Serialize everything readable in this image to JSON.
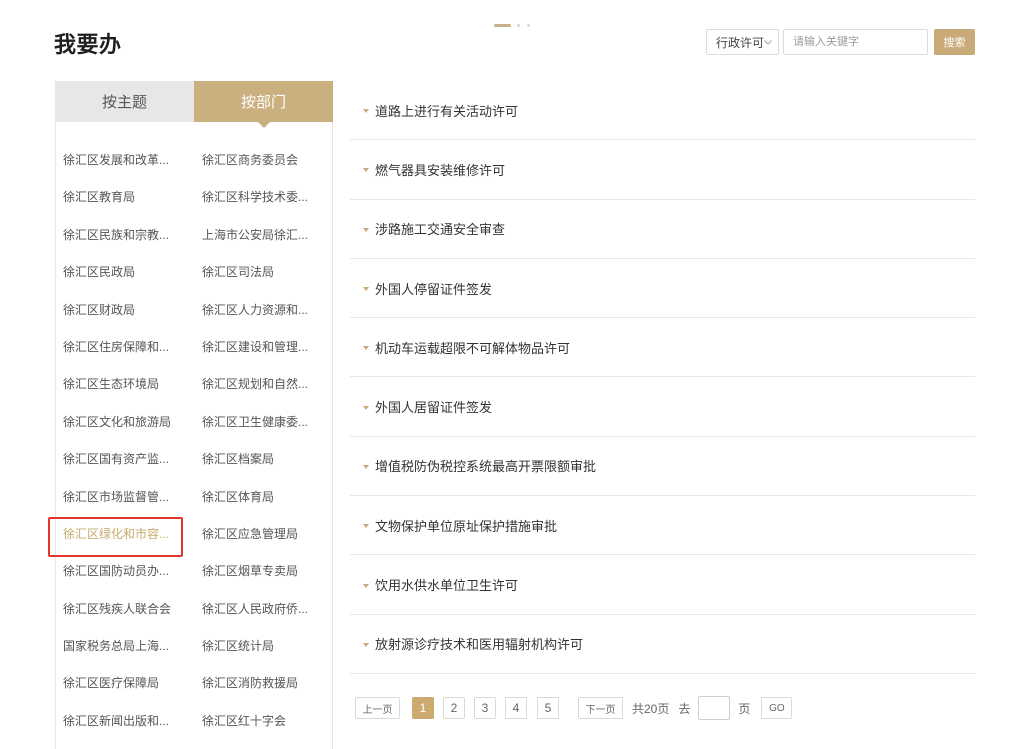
{
  "page_title": "我要办",
  "carousel": {
    "dots": 3,
    "active_index": 0
  },
  "search": {
    "category_selected": "行政许可",
    "query_placeholder": "请输入关键字",
    "query_value": "",
    "button_label": "搜索"
  },
  "tabs": [
    {
      "label": "按主题",
      "active": false
    },
    {
      "label": "按部门",
      "active": true
    }
  ],
  "departments": [
    "徐汇区发展和改革...",
    "徐汇区商务委员会",
    "徐汇区教育局",
    "徐汇区科学技术委...",
    "徐汇区民族和宗教...",
    "上海市公安局徐汇...",
    "徐汇区民政局",
    "徐汇区司法局",
    "徐汇区财政局",
    "徐汇区人力资源和...",
    "徐汇区住房保障和...",
    "徐汇区建设和管理...",
    "徐汇区生态环境局",
    "徐汇区规划和自然...",
    "徐汇区文化和旅游局",
    "徐汇区卫生健康委...",
    "徐汇区国有资产监...",
    "徐汇区档案局",
    "徐汇区市场监督管...",
    "徐汇区体育局",
    "徐汇区绿化和市容...",
    "徐汇区应急管理局",
    "徐汇区国防动员办...",
    "徐汇区烟草专卖局",
    "徐汇区残疾人联合会",
    "徐汇区人民政府侨...",
    "国家税务总局上海...",
    "徐汇区统计局",
    "徐汇区医疗保障局",
    "徐汇区消防救援局",
    "徐汇区新闻出版和...",
    "徐汇区红十字会"
  ],
  "selected_department_index": 20,
  "services": [
    "道路上进行有关活动许可",
    "燃气器具安装维修许可",
    "涉路施工交通安全审查",
    "外国人停留证件签发",
    "机动车运载超限不可解体物品许可",
    "外国人居留证件签发",
    "增值税防伪税控系统最高开票限额审批",
    "文物保护单位原址保护措施审批",
    "饮用水供水单位卫生许可",
    "放射源诊疗技术和医用辐射机构许可"
  ],
  "pagination": {
    "prev_label": "上一页",
    "pages": [
      "1",
      "2",
      "3",
      "4",
      "5"
    ],
    "current_page": 1,
    "next_label": "下一页",
    "total_label": "共20页",
    "goto_label": "去",
    "goto_value": "",
    "page_unit_label": "页",
    "go_label": "GO"
  },
  "icons": {
    "category_dropdown": "chevron-down-icon",
    "service_item": "caret-down-icon",
    "active_tab_pointer": "triangle-down-icon"
  },
  "colors": {
    "accent": "#c9ab79",
    "selected_text": "#c9a96c",
    "highlight_border": "#e2372c",
    "inactive_tab_bg": "#e7e7e7",
    "text": "#333333"
  }
}
